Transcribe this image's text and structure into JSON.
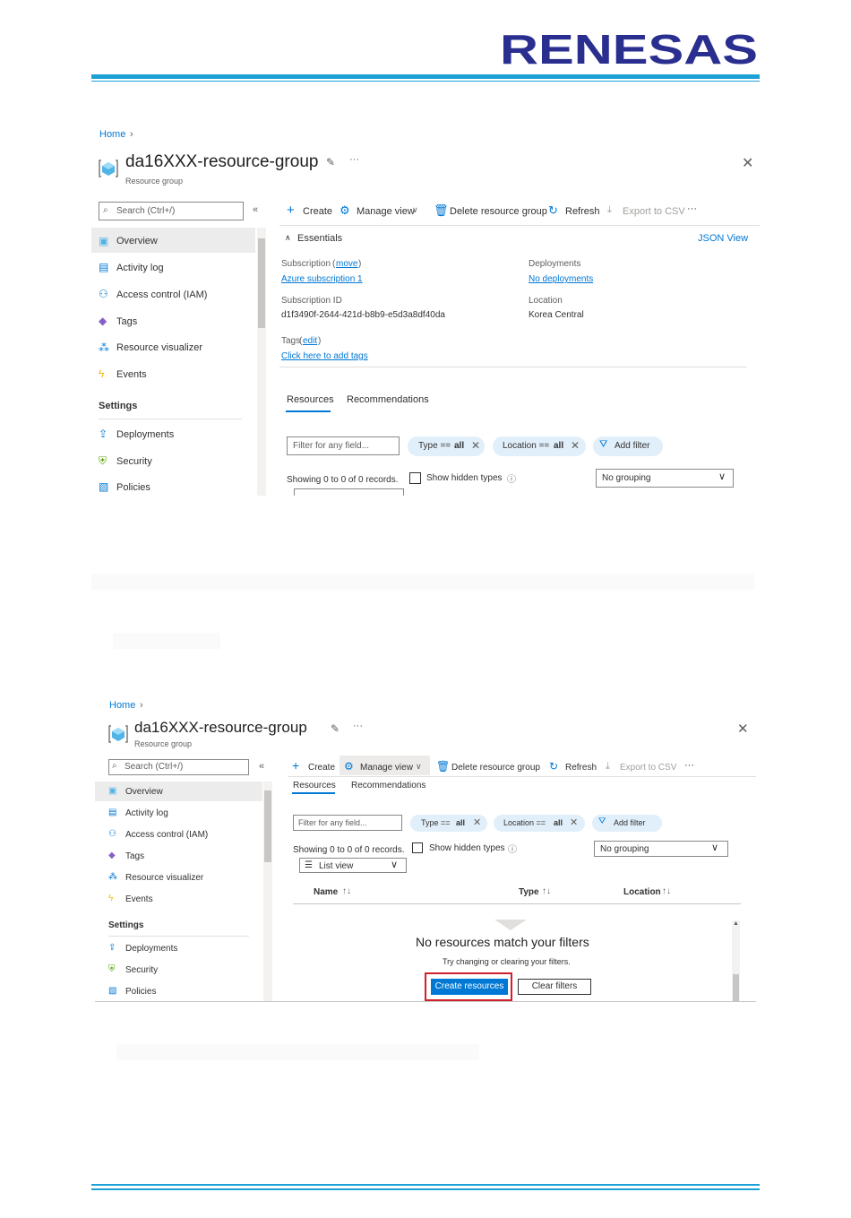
{
  "brand": {
    "logo_text": "RENESAS",
    "color": "#2a2f8f",
    "rule_color": "#1ba1d6"
  },
  "screen1": {
    "breadcrumb": "Home",
    "title": "da16XXX-resource-group",
    "subtitle": "Resource group",
    "search_placeholder": "Search (Ctrl+/)",
    "collapse_glyph": "«",
    "nav": [
      {
        "label": "Overview",
        "icon": "resource-group-icon",
        "selected": true
      },
      {
        "label": "Activity log",
        "icon": "activity-log-icon"
      },
      {
        "label": "Access control (IAM)",
        "icon": "iam-icon"
      },
      {
        "label": "Tags",
        "icon": "tag-icon"
      },
      {
        "label": "Resource visualizer",
        "icon": "visualizer-icon"
      },
      {
        "label": "Events",
        "icon": "events-icon"
      }
    ],
    "settings_header": "Settings",
    "settings_nav": [
      {
        "label": "Deployments",
        "icon": "deploy-icon"
      },
      {
        "label": "Security",
        "icon": "shield-icon"
      },
      {
        "label": "Policies",
        "icon": "policy-icon"
      }
    ],
    "toolbar": {
      "create": "Create",
      "manage_view": "Manage view",
      "delete": "Delete resource group",
      "refresh": "Refresh",
      "export": "Export to CSV",
      "more": "···"
    },
    "essentials": {
      "header": "Essentials",
      "json_view": "JSON View",
      "subscription_label": "Subscription",
      "move_link": "move",
      "subscription_value": "Azure subscription 1",
      "subscription_id_label": "Subscription ID",
      "subscription_id_value": "d1f3490f-2644-421d-b8b9-e5d3a8df40da",
      "tags_label": "Tags",
      "edit_link": "edit",
      "tags_value": "Click here to add tags",
      "deployments_label": "Deployments",
      "deployments_value": "No deployments",
      "location_label": "Location",
      "location_value": "Korea Central"
    },
    "tabs": [
      "Resources",
      "Recommendations"
    ],
    "filter_placeholder": "Filter for any field...",
    "pills": {
      "type_prefix": "Type == ",
      "type_value": "all",
      "location_prefix": "Location == ",
      "location_value": "all",
      "add_filter": "Add filter"
    },
    "records": "Showing 0 to 0 of 0 records.",
    "show_hidden": "Show hidden types",
    "grouping": "No grouping"
  },
  "screen2": {
    "breadcrumb": "Home",
    "title": "da16XXX-resource-group",
    "subtitle": "Resource group",
    "search_placeholder": "Search (Ctrl+/)",
    "collapse_glyph": "«",
    "nav": [
      {
        "label": "Overview",
        "icon": "resource-group-icon",
        "selected": true
      },
      {
        "label": "Activity log",
        "icon": "activity-log-icon"
      },
      {
        "label": "Access control (IAM)",
        "icon": "iam-icon"
      },
      {
        "label": "Tags",
        "icon": "tag-icon"
      },
      {
        "label": "Resource visualizer",
        "icon": "visualizer-icon"
      },
      {
        "label": "Events",
        "icon": "events-icon"
      }
    ],
    "settings_header": "Settings",
    "settings_nav": [
      {
        "label": "Deployments",
        "icon": "deploy-icon"
      },
      {
        "label": "Security",
        "icon": "shield-icon"
      },
      {
        "label": "Policies",
        "icon": "policy-icon"
      }
    ],
    "toolbar": {
      "create": "Create",
      "manage_view": "Manage view",
      "delete": "Delete resource group",
      "refresh": "Refresh",
      "export": "Export to CSV",
      "more": "···"
    },
    "tabs": [
      "Resources",
      "Recommendations"
    ],
    "filter_placeholder": "Filter for any field...",
    "pills": {
      "type_prefix": "Type == ",
      "type_value": "all",
      "location_prefix": "Location == ",
      "location_value": "all",
      "add_filter": "Add filter"
    },
    "records": "Showing 0 to 0 of 0 records.",
    "show_hidden": "Show hidden types",
    "grouping": "No grouping",
    "list_view": "List view",
    "columns": [
      "Name",
      "Type",
      "Location"
    ],
    "sort_glyph": "↑↓",
    "empty_title": "No resources match your filters",
    "empty_hint": "Try changing or clearing your filters.",
    "create_resources": "Create resources",
    "clear_filters": "Clear filters"
  }
}
